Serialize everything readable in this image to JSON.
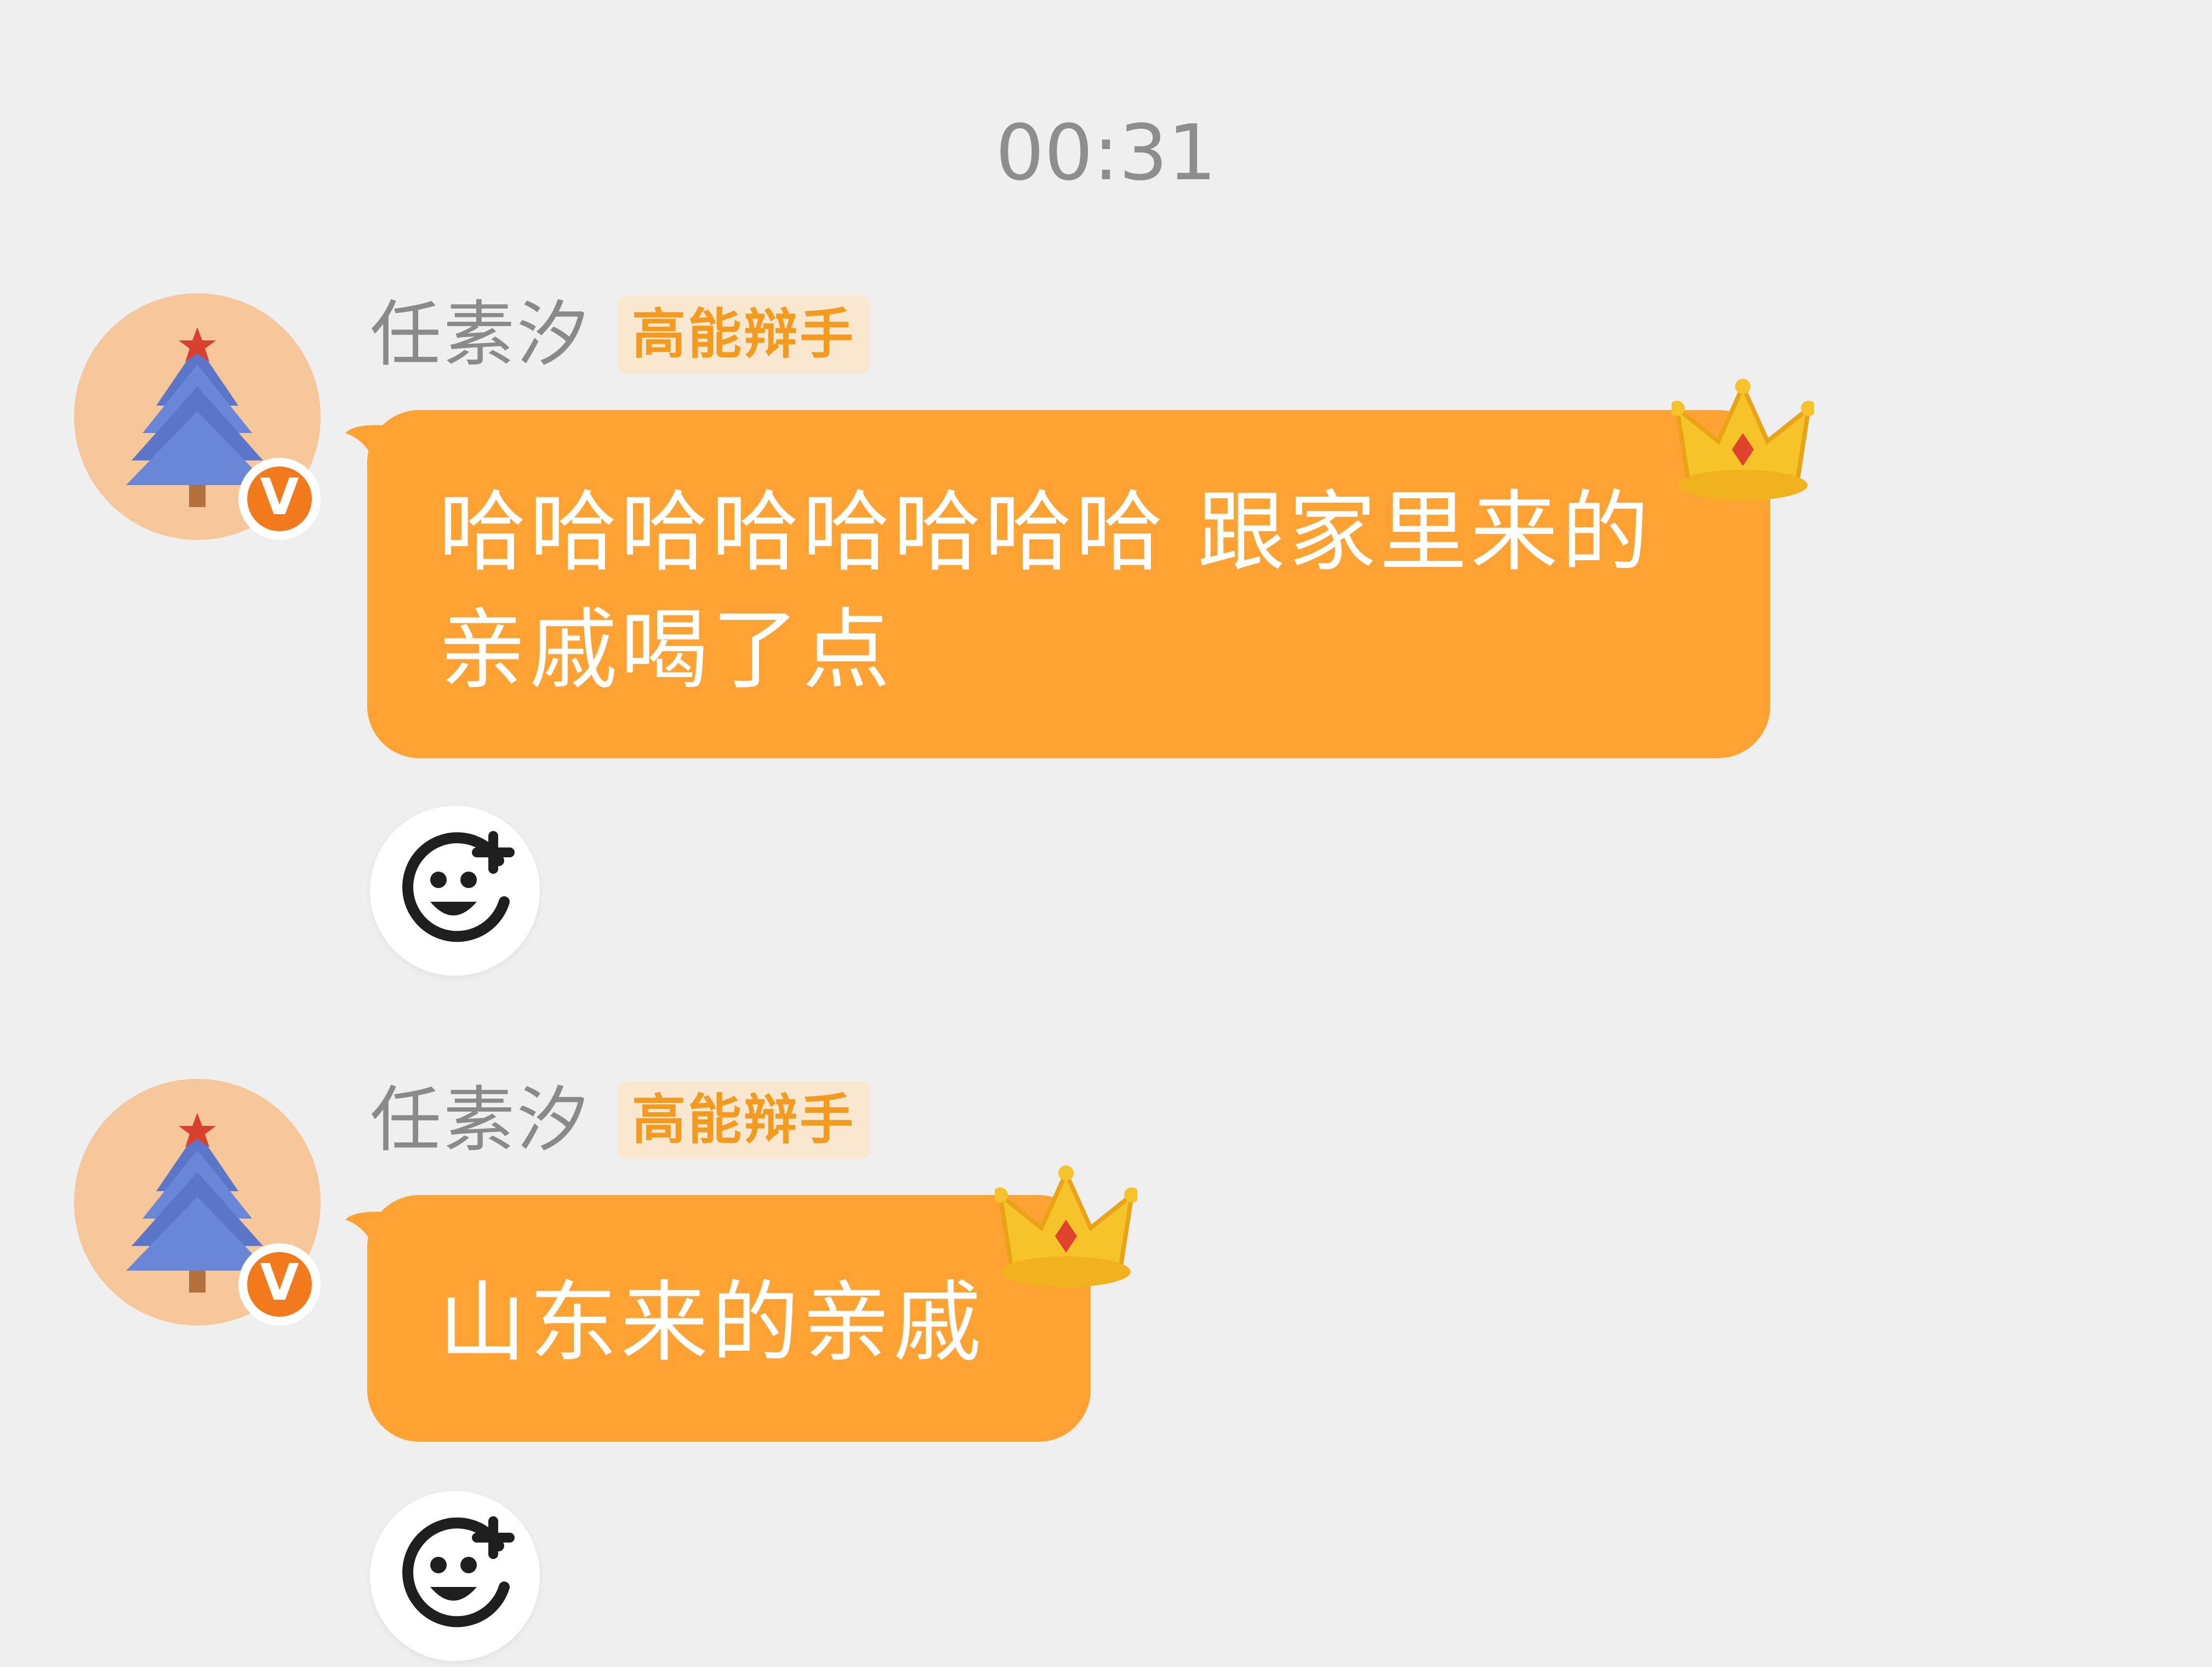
{
  "chat": {
    "timestamp": "00:31",
    "messages": [
      {
        "sender_name": "任素汐",
        "rank_badge": "高能辩手",
        "verified_badge": "V",
        "avatar_icon": "christmas-tree-icon",
        "decoration_icon": "crown-icon",
        "text": "哈哈哈哈哈哈哈哈 跟家里来的亲戚喝了点"
      },
      {
        "sender_name": "任素汐",
        "rank_badge": "高能辩手",
        "verified_badge": "V",
        "avatar_icon": "christmas-tree-icon",
        "decoration_icon": "crown-icon",
        "text": "山东来的亲戚"
      }
    ],
    "reaction_icon": "add-emoji-icon"
  },
  "colors": {
    "background": "#efefef",
    "bubble": "#fea234",
    "rank_badge_text": "#f49a1e",
    "rank_badge_bg": "#f9e7cf",
    "verified_badge": "#f07a1c",
    "timestamp_text": "#8e8e8e",
    "sender_name_text": "#8a8a8a"
  }
}
